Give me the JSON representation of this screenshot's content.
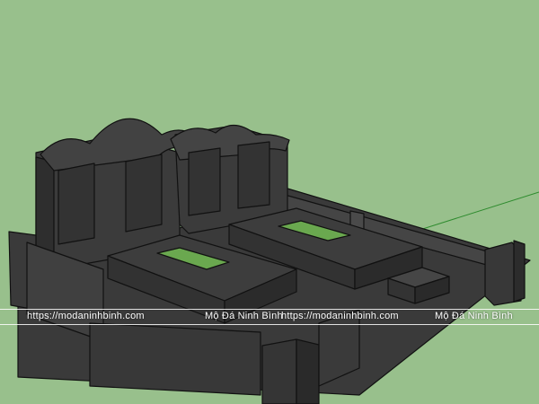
{
  "scene": {
    "background_color": "#98c08c",
    "stone_color": "#3c3c3c",
    "stone_dark": "#2a2a2a",
    "stone_light": "#4e4e4e",
    "edge_color": "#111111",
    "glass_color": "#6aa84f",
    "axis_color": "#2e8b2e"
  },
  "watermark": {
    "url_1": "https://modaninhbinh.com",
    "brand_1": "Mộ Đá Ninh Bình",
    "url_2": "https://modaninhbinh.com",
    "brand_2": "Mộ Đá Ninh Bình"
  }
}
